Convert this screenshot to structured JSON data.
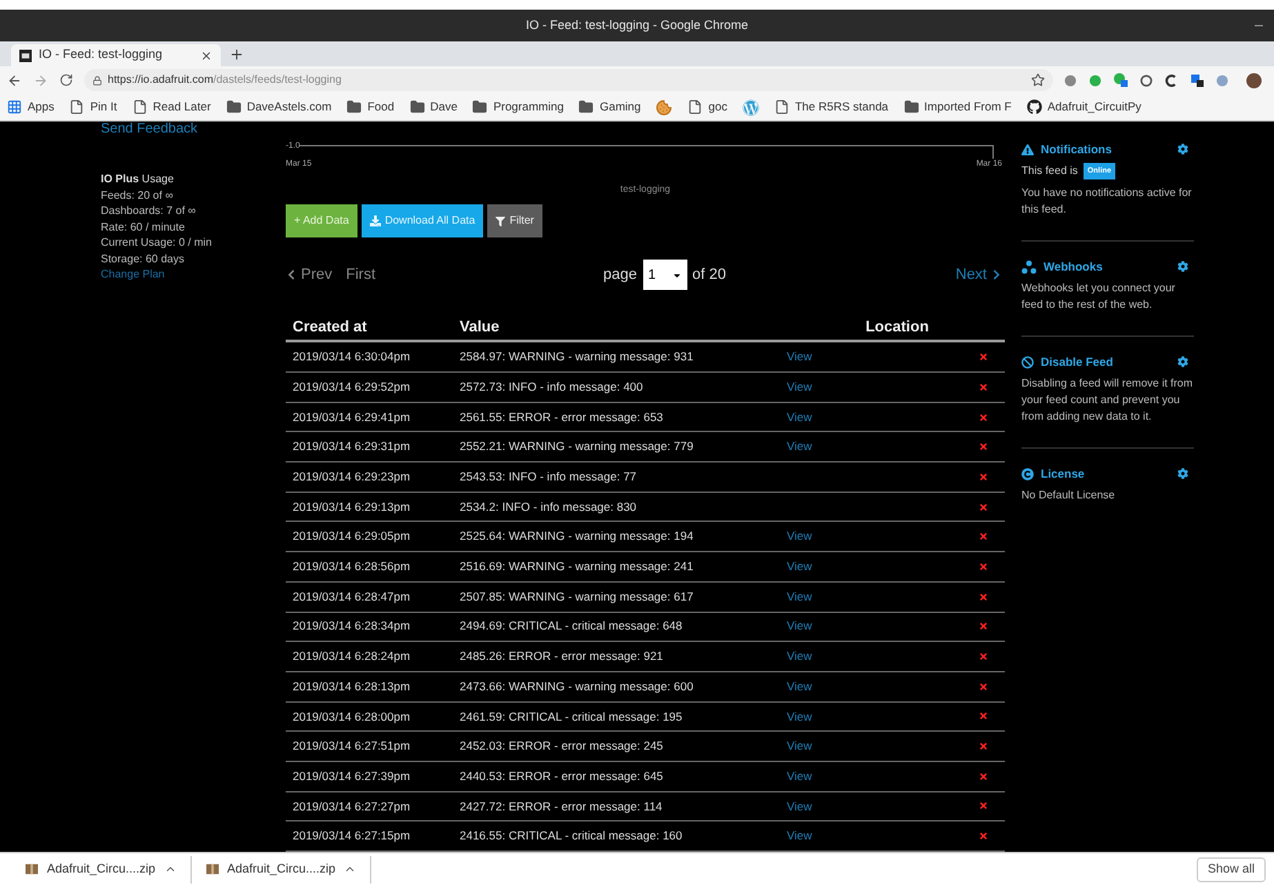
{
  "window": {
    "title": "IO - Feed: test-logging - Google Chrome"
  },
  "tab": {
    "title": "IO - Feed: test-logging"
  },
  "address": {
    "host": "https://io.adafruit.com",
    "path": "/dastels/feeds/test-logging"
  },
  "bookmarks": [
    {
      "kind": "apps",
      "label": "Apps"
    },
    {
      "kind": "page",
      "label": "Pin It"
    },
    {
      "kind": "page",
      "label": "Read Later"
    },
    {
      "kind": "folder",
      "label": "DaveAstels.com"
    },
    {
      "kind": "folder",
      "label": "Food"
    },
    {
      "kind": "folder",
      "label": "Dave"
    },
    {
      "kind": "folder",
      "label": "Programming"
    },
    {
      "kind": "folder",
      "label": "Gaming"
    },
    {
      "kind": "cookie"
    },
    {
      "kind": "page",
      "label": "goc"
    },
    {
      "kind": "wordpress"
    },
    {
      "kind": "page",
      "label": "The R5RS standa"
    },
    {
      "kind": "folder",
      "label": "Imported From F"
    },
    {
      "kind": "github",
      "label": "Adafruit_CircuitPy"
    }
  ],
  "sidebar": {
    "feedback": "Send Feedback",
    "plan": "**IO Plus** Usage",
    "lines": [
      "Feeds: 20 of ∞",
      "Dashboards: 7 of ∞",
      "Rate: 60 / minute",
      "Current Usage: 0 / min",
      "Storage: 60 days"
    ],
    "link": "Change Plan"
  },
  "chart": {
    "y_tick": "-1.0",
    "x_start": "Mar 15",
    "x_end": "Mar 16",
    "legend": "test-logging"
  },
  "actions": [
    {
      "kind": "add",
      "label": "+ Add Data"
    },
    {
      "kind": "download",
      "label": "Download All Data"
    },
    {
      "kind": "filter",
      "label": "Filter"
    }
  ],
  "pagination": {
    "prev": "Prev",
    "first": "First",
    "page_label": "page",
    "page": "1",
    "total": "of 20",
    "next": "Next"
  },
  "table": {
    "columns": [
      "Created at",
      "Value",
      "Location"
    ],
    "rows": [
      {
        "created": "2019/03/14 6:30:04pm",
        "value": "2584.97: WARNING - warning message: 931",
        "location": "View"
      },
      {
        "created": "2019/03/14 6:29:52pm",
        "value": "2572.73: INFO - info message: 400",
        "location": "View"
      },
      {
        "created": "2019/03/14 6:29:41pm",
        "value": "2561.55: ERROR - error message: 653",
        "location": "View"
      },
      {
        "created": "2019/03/14 6:29:31pm",
        "value": "2552.21: WARNING - warning message: 779",
        "location": "View"
      },
      {
        "created": "2019/03/14 6:29:23pm",
        "value": "2543.53: INFO - info message: 77"
      },
      {
        "created": "2019/03/14 6:29:13pm",
        "value": "2534.2: INFO - info message: 830"
      },
      {
        "created": "2019/03/14 6:29:05pm",
        "value": "2525.64: WARNING - warning message: 194",
        "location": "View"
      },
      {
        "created": "2019/03/14 6:28:56pm",
        "value": "2516.69: WARNING - warning message: 241",
        "location": "View"
      },
      {
        "created": "2019/03/14 6:28:47pm",
        "value": "2507.85: WARNING - warning message: 617",
        "location": "View"
      },
      {
        "created": "2019/03/14 6:28:34pm",
        "value": "2494.69: CRITICAL - critical message: 648",
        "location": "View"
      },
      {
        "created": "2019/03/14 6:28:24pm",
        "value": "2485.26: ERROR - error message: 921",
        "location": "View"
      },
      {
        "created": "2019/03/14 6:28:13pm",
        "value": "2473.66: WARNING - warning message: 600",
        "location": "View"
      },
      {
        "created": "2019/03/14 6:28:00pm",
        "value": "2461.59: CRITICAL - critical message: 195",
        "location": "View"
      },
      {
        "created": "2019/03/14 6:27:51pm",
        "value": "2452.03: ERROR - error message: 245",
        "location": "View"
      },
      {
        "created": "2019/03/14 6:27:39pm",
        "value": "2440.53: ERROR - error message: 645",
        "location": "View"
      },
      {
        "created": "2019/03/14 6:27:27pm",
        "value": "2427.72: ERROR - error message: 114",
        "location": "View"
      },
      {
        "created": "2019/03/14 6:27:15pm",
        "value": "2416.55: CRITICAL - critical message: 160",
        "location": "View"
      }
    ]
  },
  "panels": [
    {
      "kind": "notifications",
      "title": "Notifications",
      "status_prefix": "This feed is",
      "status": "Online",
      "text": "You have no notifications active for this feed."
    },
    {
      "kind": "webhooks",
      "title": "Webhooks",
      "text": "Webhooks let you connect your feed to the rest of the web."
    },
    {
      "kind": "disable",
      "title": "Disable Feed",
      "text": "Disabling a feed will remove it from your feed count and prevent you from adding new data to it."
    },
    {
      "kind": "license",
      "title": "License",
      "text": "No Default License"
    }
  ],
  "downloads": [
    {
      "name": "Adafruit_Circu....zip"
    },
    {
      "name": "Adafruit_Circu....zip"
    }
  ],
  "show_all": "Show all"
}
